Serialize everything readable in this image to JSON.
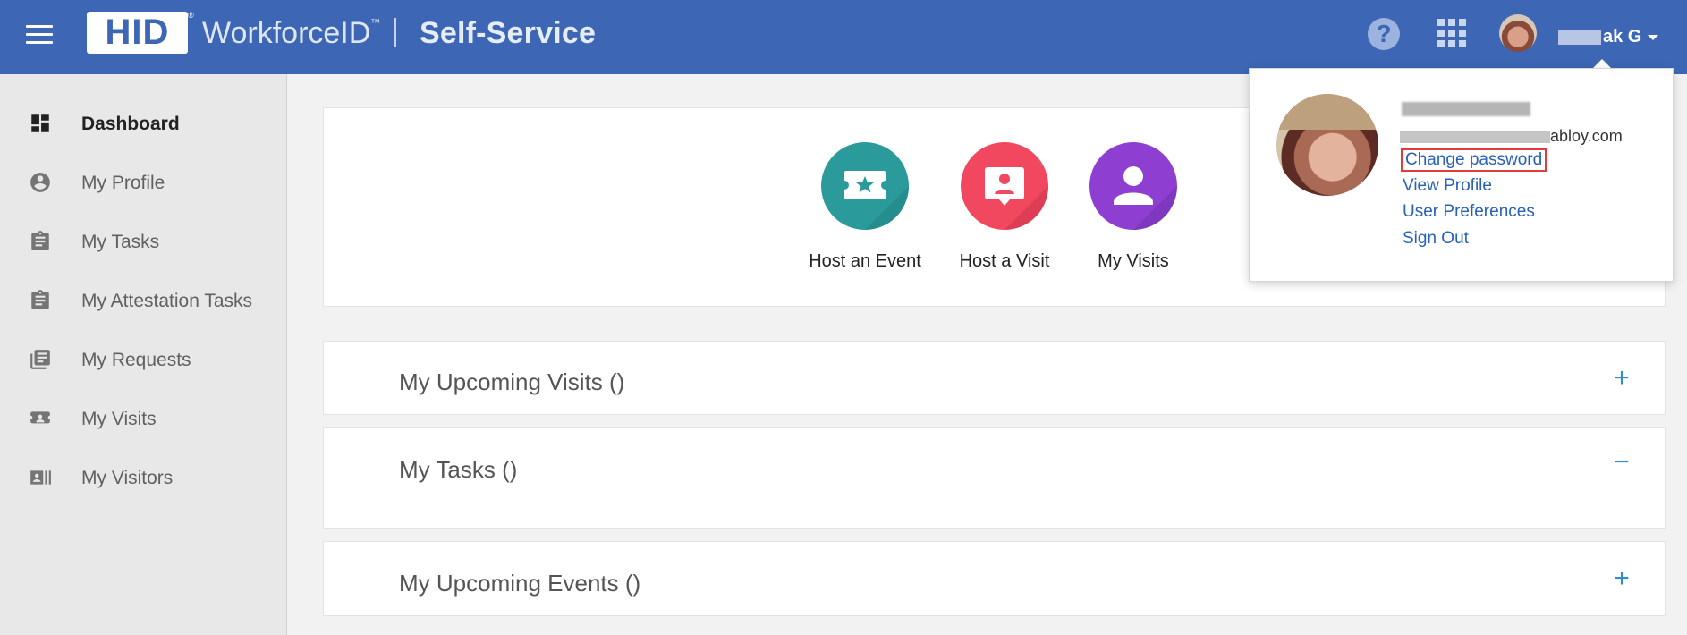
{
  "header": {
    "logo": "HID",
    "brand": "WorkforceID",
    "brand_tm": "™",
    "app_name": "Self-Service",
    "user_name": "ak G"
  },
  "sidebar": {
    "items": [
      {
        "label": "Dashboard",
        "icon": "dashboard-icon"
      },
      {
        "label": "My Profile",
        "icon": "account-circle-icon"
      },
      {
        "label": "My Tasks",
        "icon": "clipboard-icon"
      },
      {
        "label": "My Attestation Tasks",
        "icon": "clipboard-icon"
      },
      {
        "label": "My Requests",
        "icon": "library-books-icon"
      },
      {
        "label": "My Visits",
        "icon": "badge-icon"
      },
      {
        "label": "My Visitors",
        "icon": "contacts-icon"
      }
    ]
  },
  "quick_actions": [
    {
      "label": "Host an Event",
      "color": "#2a9a9a",
      "icon": "ticket-star-icon"
    },
    {
      "label": "Host a Visit",
      "color": "#f1485f",
      "icon": "person-badge-icon"
    },
    {
      "label": "My Visits",
      "color": "#8e3fd2",
      "icon": "person-icon"
    }
  ],
  "sections": [
    {
      "title": "My Upcoming Visits ()",
      "toggle": "+"
    },
    {
      "title": "My Tasks ()",
      "toggle": "−"
    },
    {
      "title": "My Upcoming Events ()",
      "toggle": "+"
    }
  ],
  "user_menu": {
    "email_suffix": "abloy.com",
    "links": [
      "Change password",
      "View Profile",
      "User Preferences",
      "Sign Out"
    ]
  },
  "colors": {
    "header": "#3d67b5",
    "link": "#2861b8",
    "highlight": "#e03a3a"
  }
}
